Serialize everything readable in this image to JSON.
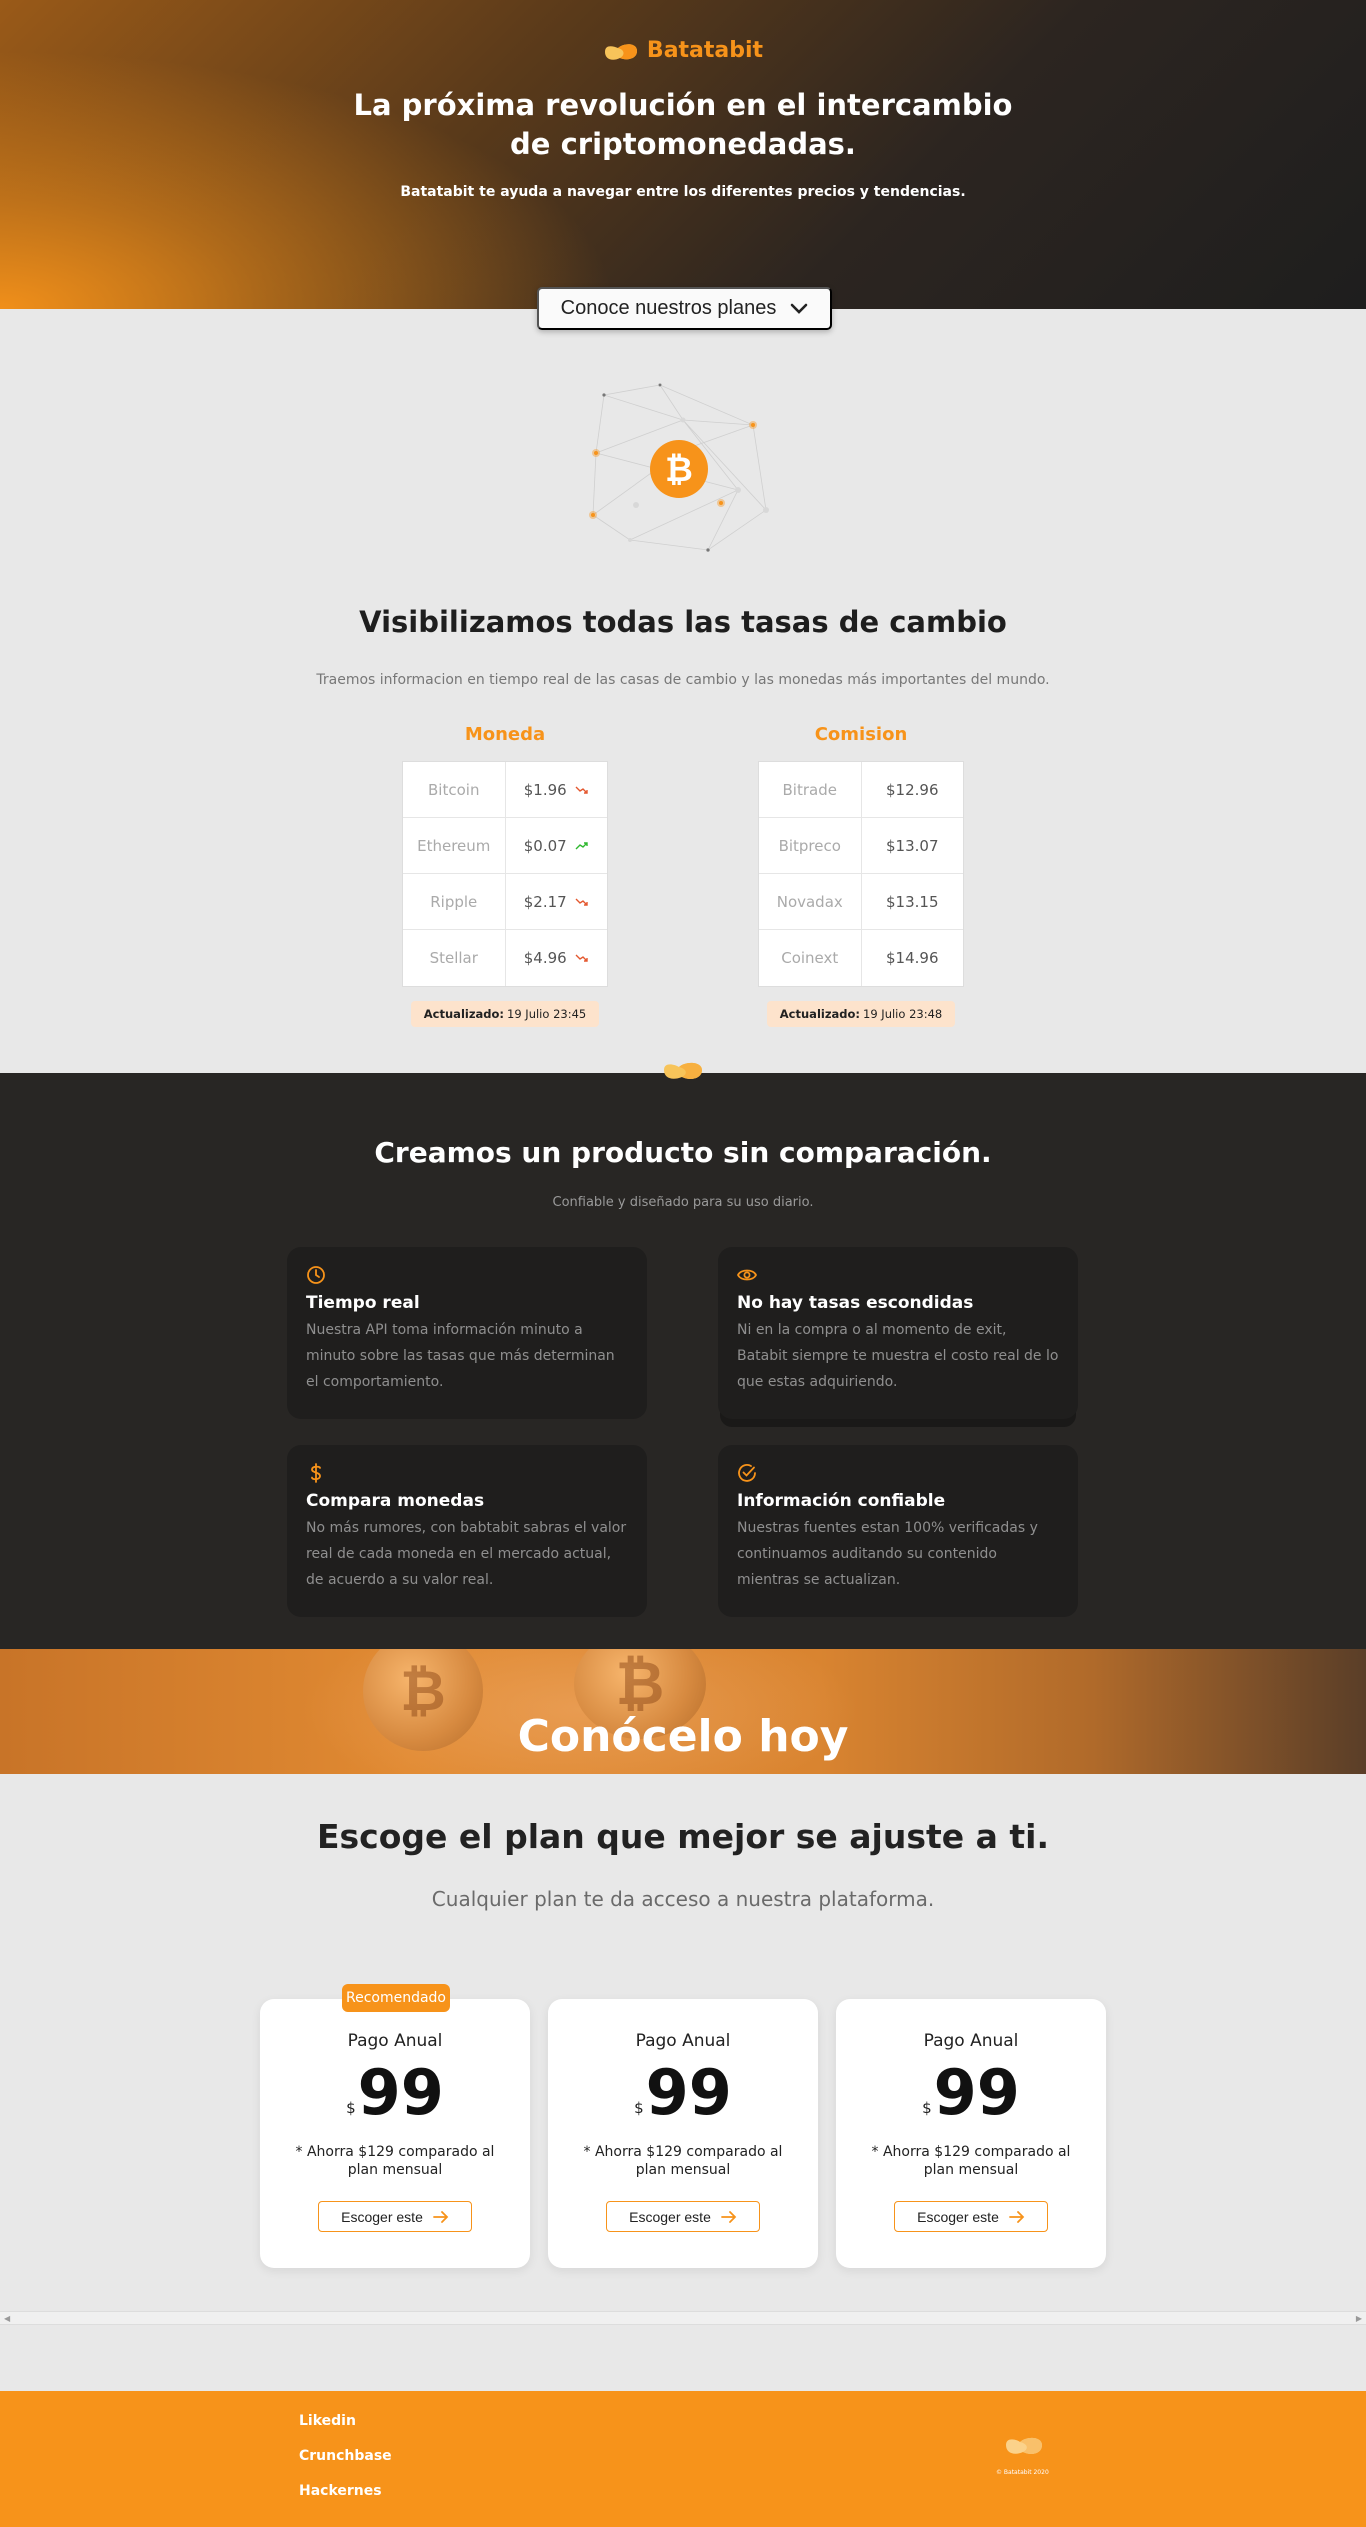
{
  "brand": "Batatabit",
  "hero": {
    "title": "La próxima revolución en el intercambio de criptomonedadas.",
    "subtitle": "Batatabit te ayuda a navegar entre los diferentes precios y tendencias.",
    "plans_button": "Conoce nuestros planes"
  },
  "rates": {
    "title": "Visibilizamos todas las tasas de cambio",
    "subtitle": "Traemos informacion en tiempo real de las casas de cambio y las monedas más importantes del mundo.",
    "currency_table": {
      "header": "Moneda",
      "rows": [
        {
          "name": "Bitcoin",
          "value": "$1.96",
          "trend": "down"
        },
        {
          "name": "Ethereum",
          "value": "$0.07",
          "trend": "up"
        },
        {
          "name": "Ripple",
          "value": "$2.17",
          "trend": "down"
        },
        {
          "name": "Stellar",
          "value": "$4.96",
          "trend": "down"
        }
      ],
      "updated_label": "Actualizado:",
      "updated_value": "19 Julio 23:45"
    },
    "commission_table": {
      "header": "Comision",
      "rows": [
        {
          "name": "Bitrade",
          "value": "$12.96"
        },
        {
          "name": "Bitpreco",
          "value": "$13.07"
        },
        {
          "name": "Novadax",
          "value": "$13.15"
        },
        {
          "name": "Coinext",
          "value": "$14.96"
        }
      ],
      "updated_label": "Actualizado:",
      "updated_value": "19 Julio 23:48"
    }
  },
  "features": {
    "title": "Creamos un producto sin comparación.",
    "subtitle": "Confiable y diseñado para su uso diario.",
    "cards": [
      {
        "icon": "clock-icon",
        "title": "Tiempo real",
        "text": "Nuestra API toma información minuto a minuto sobre las tasas que más determinan el comportamiento."
      },
      {
        "icon": "eye-icon",
        "title": "No hay tasas escondidas",
        "text": "Ni en la compra o al momento de exit, Batabit siempre te muestra el costo real de lo que estas adquiriendo."
      },
      {
        "icon": "dollar-icon",
        "title": "Compara monedas",
        "text": "No más rumores, con babtabit sabras el valor real de cada moneda en el mercado actual, de acuerdo a su valor real."
      },
      {
        "icon": "check-circle-icon",
        "title": "Información confiable",
        "text": "Nuestras fuentes estan 100% verificadas y continuamos auditando su contenido mientras se actualizan."
      }
    ]
  },
  "banner": {
    "title": "Conócelo hoy"
  },
  "plans": {
    "title": "Escoge el plan que mejor se ajuste a ti.",
    "subtitle": "Cualquier plan te da acceso a nuestra plataforma.",
    "badge": "Recomendado",
    "items": [
      {
        "label": "Pago Anual",
        "currency": "$",
        "price": "99",
        "note": "* Ahorra $129 comparado al plan mensual",
        "button": "Escoger este"
      },
      {
        "label": "Pago Anual",
        "currency": "$",
        "price": "99",
        "note": "* Ahorra $129 comparado al plan mensual",
        "button": "Escoger este"
      },
      {
        "label": "Pago Anual",
        "currency": "$",
        "price": "99",
        "note": "* Ahorra $129 comparado al plan mensual",
        "button": "Escoger este"
      }
    ]
  },
  "footer": {
    "links": [
      "Likedin",
      "Crunchbase",
      "Hackernes"
    ],
    "copyright": "© Batatabit 2020"
  },
  "colors": {
    "accent": "#f7931a",
    "dark": "#282624",
    "light": "#e8e8e8",
    "down": "#e4572e",
    "up": "#2eb82e"
  }
}
